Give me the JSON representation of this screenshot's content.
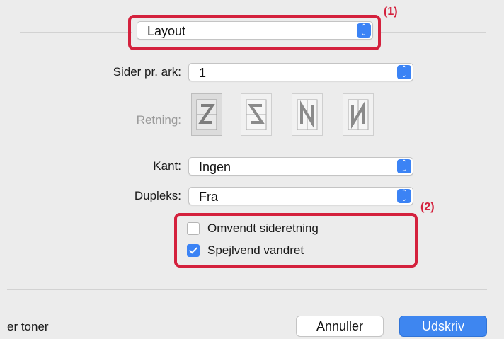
{
  "header": {
    "panel_popup": "Layout"
  },
  "form": {
    "pages_per_sheet": {
      "label": "Sider pr. ark:",
      "value": "1"
    },
    "direction": {
      "label": "Retning:",
      "options_icons": [
        "z-order-icon",
        "reverse-z-order-icon",
        "n-order-icon",
        "reverse-n-order-icon"
      ],
      "selected_index": 0
    },
    "border": {
      "label": "Kant:",
      "value": "Ingen"
    },
    "duplex": {
      "label": "Dupleks:",
      "value": "Fra"
    },
    "checkboxes": [
      {
        "label": "Omvendt sideretning",
        "checked": false
      },
      {
        "label": "Spejlvend vandret",
        "checked": true
      }
    ]
  },
  "callouts": {
    "one": "(1)",
    "two": "(2)"
  },
  "footer": {
    "left_text": "er toner",
    "cancel_label": "Annuller",
    "print_label": "Udskriv"
  },
  "colors": {
    "accent": "#3b83f5",
    "highlight": "#d4213d"
  }
}
